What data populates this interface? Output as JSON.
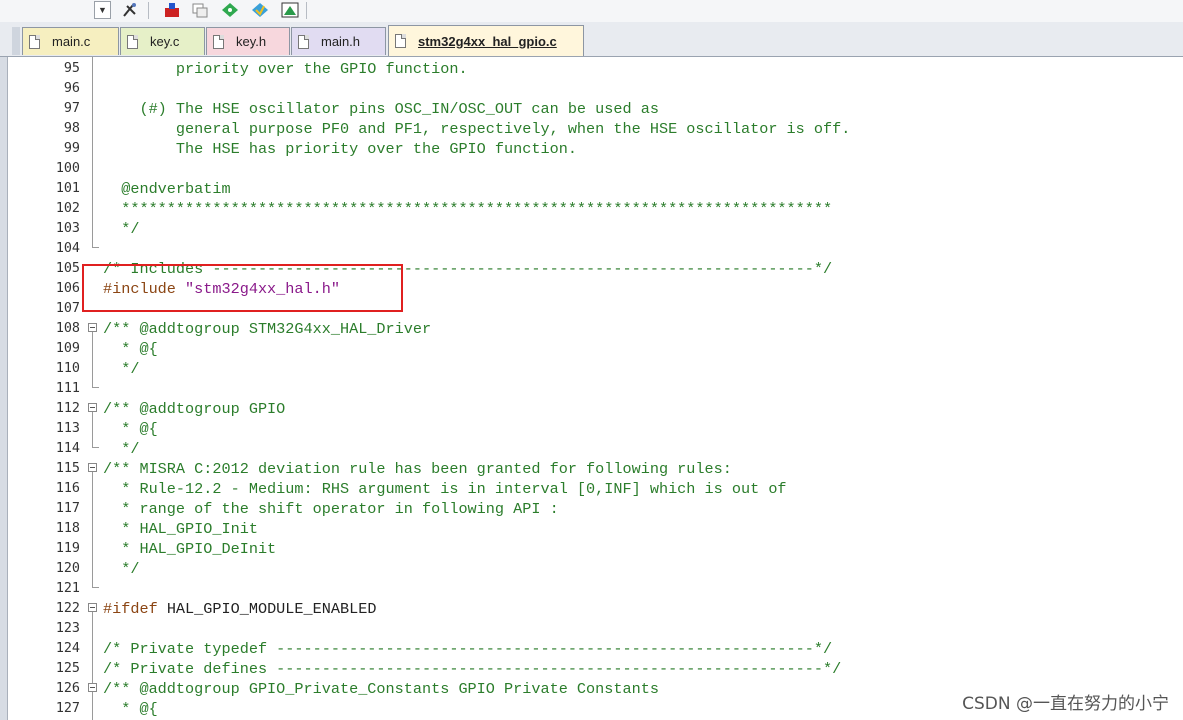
{
  "toolbar": {
    "icons": [
      "dropdown-arrow",
      "tools-icon",
      "load-icon",
      "copy-icon",
      "diamond-green-icon",
      "diamond-blue-icon",
      "window-icon"
    ]
  },
  "tabs": [
    {
      "label": "main.c",
      "color": "#f6efc0",
      "active": false
    },
    {
      "label": "key.c",
      "color": "#e6f0c8",
      "active": false
    },
    {
      "label": "key.h",
      "color": "#f7d7dd",
      "active": false
    },
    {
      "label": "main.h",
      "color": "#e1dcf2",
      "active": false
    },
    {
      "label": "stm32g4xx_hal_gpio.c",
      "color": "#fff6dc",
      "active": true
    }
  ],
  "editor": {
    "lines": [
      {
        "n": "95",
        "segments": [
          {
            "t": "        priority over the GPIO function.",
            "c": "cm"
          }
        ]
      },
      {
        "n": "96",
        "segments": [
          {
            "t": "",
            "c": "cm"
          }
        ]
      },
      {
        "n": "97",
        "segments": [
          {
            "t": "    (#) The HSE oscillator pins OSC_IN/OSC_OUT can be used as",
            "c": "cm"
          }
        ]
      },
      {
        "n": "98",
        "segments": [
          {
            "t": "        general purpose PF0 and PF1, respectively, when the HSE oscillator is off.",
            "c": "cm"
          }
        ]
      },
      {
        "n": "99",
        "segments": [
          {
            "t": "        The HSE has priority over the GPIO function.",
            "c": "cm"
          }
        ]
      },
      {
        "n": "100",
        "segments": [
          {
            "t": "",
            "c": "cm"
          }
        ]
      },
      {
        "n": "101",
        "segments": [
          {
            "t": "  @endverbatim",
            "c": "cm"
          }
        ]
      },
      {
        "n": "102",
        "segments": [
          {
            "t": "  ******************************************************************************",
            "c": "cm"
          }
        ]
      },
      {
        "n": "103",
        "segments": [
          {
            "t": "  */",
            "c": "cm"
          }
        ]
      },
      {
        "n": "104",
        "segments": [
          {
            "t": "",
            "c": "cm"
          }
        ]
      },
      {
        "n": "105",
        "segments": [
          {
            "t": "/* Includes ------------------------------------------------------------------*/",
            "c": "cm"
          }
        ]
      },
      {
        "n": "106",
        "segments": [
          {
            "t": "#include ",
            "c": "pp"
          },
          {
            "t": "\"stm32g4xx_hal.h\"",
            "c": "str"
          }
        ]
      },
      {
        "n": "107",
        "segments": [
          {
            "t": "",
            "c": "cm"
          }
        ]
      },
      {
        "n": "108",
        "segments": [
          {
            "t": "/** @addtogroup STM32G4xx_HAL_Driver",
            "c": "cm"
          }
        ]
      },
      {
        "n": "109",
        "segments": [
          {
            "t": "  * @{",
            "c": "cm"
          }
        ]
      },
      {
        "n": "110",
        "segments": [
          {
            "t": "  */",
            "c": "cm"
          }
        ]
      },
      {
        "n": "111",
        "segments": [
          {
            "t": "",
            "c": "cm"
          }
        ]
      },
      {
        "n": "112",
        "segments": [
          {
            "t": "/** @addtogroup GPIO",
            "c": "cm"
          }
        ]
      },
      {
        "n": "113",
        "segments": [
          {
            "t": "  * @{",
            "c": "cm"
          }
        ]
      },
      {
        "n": "114",
        "segments": [
          {
            "t": "  */",
            "c": "cm"
          }
        ]
      },
      {
        "n": "115",
        "segments": [
          {
            "t": "/** MISRA C:2012 deviation rule has been granted for following rules:",
            "c": "cm"
          }
        ]
      },
      {
        "n": "116",
        "segments": [
          {
            "t": "  * Rule-12.2 - Medium: RHS argument is in interval [0,INF] which is out of",
            "c": "cm"
          }
        ]
      },
      {
        "n": "117",
        "segments": [
          {
            "t": "  * range of the shift operator in following API :",
            "c": "cm"
          }
        ]
      },
      {
        "n": "118",
        "segments": [
          {
            "t": "  * HAL_GPIO_Init",
            "c": "cm"
          }
        ]
      },
      {
        "n": "119",
        "segments": [
          {
            "t": "  * HAL_GPIO_DeInit",
            "c": "cm"
          }
        ]
      },
      {
        "n": "120",
        "segments": [
          {
            "t": "  */",
            "c": "cm"
          }
        ]
      },
      {
        "n": "121",
        "segments": [
          {
            "t": "",
            "c": "cm"
          }
        ]
      },
      {
        "n": "122",
        "segments": [
          {
            "t": "#ifdef ",
            "c": "pp"
          },
          {
            "t": "HAL_GPIO_MODULE_ENABLED",
            "c": "kw"
          }
        ]
      },
      {
        "n": "123",
        "segments": [
          {
            "t": "",
            "c": "cm"
          }
        ]
      },
      {
        "n": "124",
        "segments": [
          {
            "t": "/* Private typedef -----------------------------------------------------------*/",
            "c": "cm"
          }
        ]
      },
      {
        "n": "125",
        "segments": [
          {
            "t": "/* Private defines ------------------------------------------------------------*/",
            "c": "cm"
          }
        ]
      },
      {
        "n": "126",
        "segments": [
          {
            "t": "/** @addtogroup GPIO_Private_Constants GPIO Private Constants",
            "c": "cm"
          }
        ]
      },
      {
        "n": "127",
        "segments": [
          {
            "t": "  * @{",
            "c": "cm"
          }
        ]
      }
    ]
  },
  "watermark": "CSDN @一直在努力的小宁"
}
